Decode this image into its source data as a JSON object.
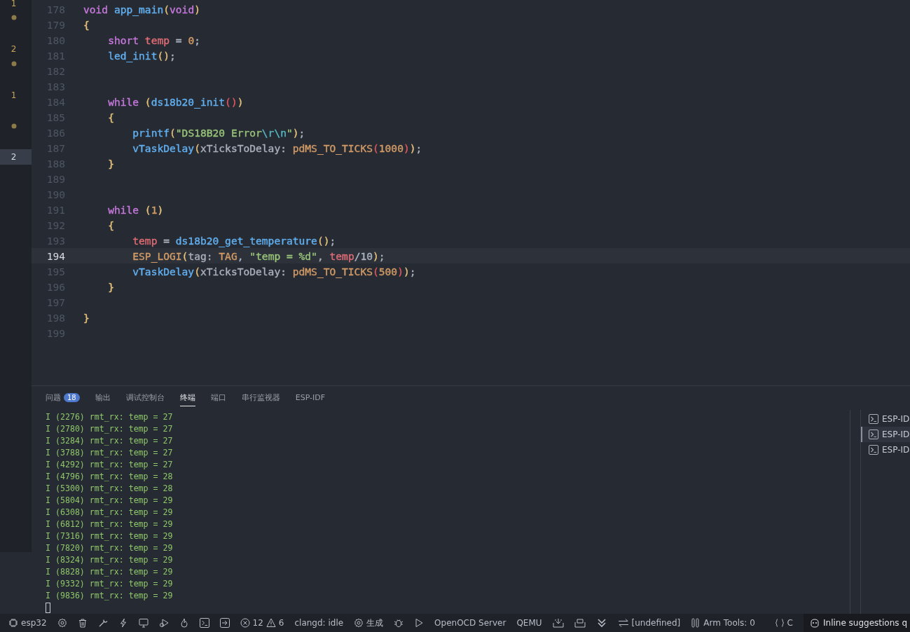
{
  "gutter_marks": [
    {
      "kind": "count",
      "text": "1",
      "selected": false
    },
    {
      "kind": "dot",
      "selected": false
    },
    {
      "kind": "count",
      "text": "2",
      "selected": false
    },
    {
      "kind": "dot",
      "selected": false
    },
    {
      "kind": "count",
      "text": "1",
      "selected": false
    },
    {
      "kind": "dot",
      "selected": false
    },
    {
      "kind": "count",
      "text": "2",
      "selected": true
    }
  ],
  "editor": {
    "lines": [
      {
        "number": "178",
        "current": false,
        "tokens": [
          {
            "t": "void",
            "color": "#c678dd"
          },
          {
            "t": " app_main",
            "color": "#61afef"
          },
          {
            "t": "(",
            "color": "#e5c07b"
          },
          {
            "t": "void",
            "color": "#c678dd"
          },
          {
            "t": ")",
            "color": "#e5c07b"
          }
        ]
      },
      {
        "number": "179",
        "current": false,
        "tokens": [
          {
            "t": "{",
            "color": "#e5c07b"
          }
        ]
      },
      {
        "number": "180",
        "current": false,
        "tokens": [
          {
            "t": "    short",
            "color": "#c678dd"
          },
          {
            "t": " temp",
            "color": "#e06c75"
          },
          {
            "t": " =",
            "color": "#abb2bf"
          },
          {
            "t": " 0",
            "color": "#d19a66"
          },
          {
            "t": ";",
            "color": "#abb2bf"
          }
        ]
      },
      {
        "number": "181",
        "current": false,
        "tokens": [
          {
            "t": "    led_init",
            "color": "#61afef"
          },
          {
            "t": "()",
            "color": "#e5c07b"
          },
          {
            "t": ";",
            "color": "#abb2bf"
          }
        ]
      },
      {
        "number": "182",
        "current": false
      },
      {
        "number": "183",
        "current": false
      },
      {
        "number": "184",
        "current": false,
        "tokens": [
          {
            "t": "    while",
            "color": "#c678dd"
          },
          {
            "t": " (",
            "color": "#e5c07b"
          },
          {
            "t": "ds18b20_init",
            "color": "#61afef"
          },
          {
            "t": "()",
            "color": "#e0575f"
          },
          {
            "t": ")",
            "color": "#e5c07b"
          }
        ]
      },
      {
        "number": "185",
        "current": false,
        "tokens": [
          {
            "t": "    {",
            "color": "#e5c07b"
          }
        ]
      },
      {
        "number": "186",
        "current": false,
        "tokens": [
          {
            "t": "        printf",
            "color": "#61afef"
          },
          {
            "t": "(",
            "color": "#e5c07b"
          },
          {
            "t": "\"DS18B20 Error",
            "color": "#98c379"
          },
          {
            "t": "\\r\\n",
            "color": "#56b6c2"
          },
          {
            "t": "\"",
            "color": "#98c379"
          },
          {
            "t": ")",
            "color": "#e5c07b"
          },
          {
            "t": ";",
            "color": "#abb2bf"
          }
        ]
      },
      {
        "number": "187",
        "current": false,
        "tokens": [
          {
            "t": "        vTaskDelay",
            "color": "#61afef"
          },
          {
            "t": "(",
            "color": "#e5c07b"
          },
          {
            "t": "xTicksToDelay:",
            "color": "#a9afba"
          },
          {
            "t": " pdMS_TO_TICKS",
            "color": "#d19a66"
          },
          {
            "t": "(",
            "color": "#e0575f"
          },
          {
            "t": "1000",
            "color": "#d19a66"
          },
          {
            "t": ")",
            "color": "#e0575f"
          },
          {
            "t": ")",
            "color": "#e5c07b"
          },
          {
            "t": ";",
            "color": "#abb2bf"
          }
        ]
      },
      {
        "number": "188",
        "current": false,
        "tokens": [
          {
            "t": "    }",
            "color": "#e5c07b"
          }
        ]
      },
      {
        "number": "189",
        "current": false
      },
      {
        "number": "190",
        "current": false
      },
      {
        "number": "191",
        "current": false,
        "tokens": [
          {
            "t": "    while",
            "color": "#c678dd"
          },
          {
            "t": " (",
            "color": "#e5c07b"
          },
          {
            "t": "1",
            "color": "#d19a66"
          },
          {
            "t": ")",
            "color": "#e5c07b"
          }
        ]
      },
      {
        "number": "192",
        "current": false,
        "tokens": [
          {
            "t": "    {",
            "color": "#e5c07b"
          }
        ]
      },
      {
        "number": "193",
        "current": false,
        "tokens": [
          {
            "t": "        temp",
            "color": "#e06c75"
          },
          {
            "t": " =",
            "color": "#abb2bf"
          },
          {
            "t": " ds18b20_get_temperature",
            "color": "#61afef"
          },
          {
            "t": "()",
            "color": "#e5c07b"
          },
          {
            "t": ";",
            "color": "#abb2bf"
          }
        ]
      },
      {
        "number": "194",
        "current": true,
        "tokens": [
          {
            "t": "        ESP_LOGI",
            "color": "#d19a66"
          },
          {
            "t": "(",
            "color": "#e5c07b"
          },
          {
            "t": "tag:",
            "color": "#a9afba"
          },
          {
            "t": " TAG",
            "color": "#d19a66"
          },
          {
            "t": ",",
            "color": "#abb2bf"
          },
          {
            "t": " \"temp = %d\"",
            "color": "#98c379"
          },
          {
            "t": ",",
            "color": "#abb2bf"
          },
          {
            "t": " temp",
            "color": "#e06c75"
          },
          {
            "t": "/10",
            "color": "#abb2bf"
          },
          {
            "t": ")",
            "color": "#e5c07b"
          },
          {
            "t": ";",
            "color": "#abb2bf"
          }
        ]
      },
      {
        "number": "195",
        "current": false,
        "tokens": [
          {
            "t": "        vTaskDelay",
            "color": "#61afef"
          },
          {
            "t": "(",
            "color": "#e5c07b"
          },
          {
            "t": "xTicksToDelay:",
            "color": "#a9afba"
          },
          {
            "t": " pdMS_TO_TICKS",
            "color": "#d19a66"
          },
          {
            "t": "(",
            "color": "#e0575f"
          },
          {
            "t": "500",
            "color": "#d19a66"
          },
          {
            "t": ")",
            "color": "#e0575f"
          },
          {
            "t": ")",
            "color": "#e5c07b"
          },
          {
            "t": ";",
            "color": "#abb2bf"
          }
        ]
      },
      {
        "number": "196",
        "current": false,
        "tokens": [
          {
            "t": "    }",
            "color": "#e5c07b"
          }
        ]
      },
      {
        "number": "197",
        "current": false
      },
      {
        "number": "198",
        "current": false,
        "tokens": [
          {
            "t": "}",
            "color": "#e5c07b"
          }
        ]
      },
      {
        "number": "199",
        "current": false
      }
    ]
  },
  "panel": {
    "tabs": [
      {
        "label": "问题",
        "badge": "18",
        "selected": false
      },
      {
        "label": "输出",
        "selected": false
      },
      {
        "label": "调试控制台",
        "selected": false
      },
      {
        "label": "终端",
        "selected": true
      },
      {
        "label": "端口",
        "selected": false
      },
      {
        "label": "串行监视器",
        "selected": false
      },
      {
        "label": "ESP-IDF",
        "selected": false
      }
    ],
    "terminal_lines": [
      "I (2276) rmt_rx: temp = 27",
      "I (2780) rmt_rx: temp = 27",
      "I (3284) rmt_rx: temp = 27",
      "I (3788) rmt_rx: temp = 27",
      "I (4292) rmt_rx: temp = 27",
      "I (4796) rmt_rx: temp = 28",
      "I (5300) rmt_rx: temp = 28",
      "I (5804) rmt_rx: temp = 29",
      "I (6308) rmt_rx: temp = 29",
      "I (6812) rmt_rx: temp = 29",
      "I (7316) rmt_rx: temp = 29",
      "I (7820) rmt_rx: temp = 29",
      "I (8324) rmt_rx: temp = 29",
      "I (8828) rmt_rx: temp = 29",
      "I (9332) rmt_rx: temp = 29",
      "I (9836) rmt_rx: temp = 29"
    ],
    "terminals": [
      {
        "label": "ESP-ID",
        "selected": false
      },
      {
        "label": "ESP-ID",
        "selected": true
      },
      {
        "label": "ESP-ID",
        "selected": false
      }
    ]
  },
  "status_bar": {
    "board": "esp32",
    "errors": "12",
    "warnings": "6",
    "clangd": "clangd: idle",
    "build": "生成",
    "openocd": "OpenOCD Server",
    "qemu": "QEMU",
    "port": "[undefined]",
    "arm_tools": "Arm Tools: 0",
    "language": "C",
    "inline_suggestions": "Inline suggestions q"
  }
}
